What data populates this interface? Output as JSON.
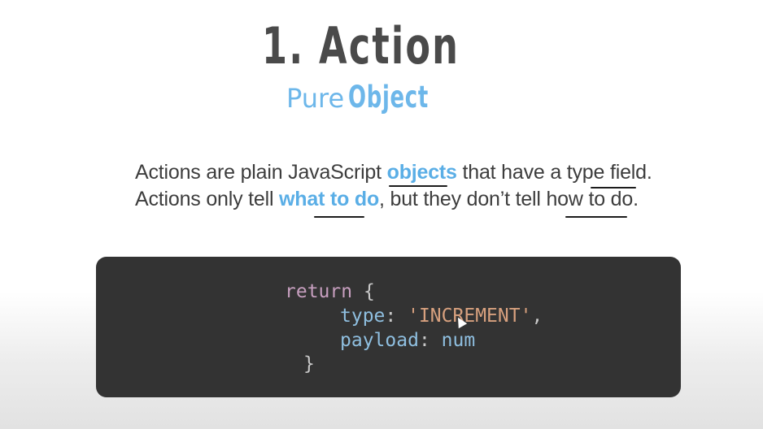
{
  "slide": {
    "title": "1. Action",
    "subtitle_plain": "Pure",
    "subtitle_bold": "Object",
    "line1": {
      "before": "Actions are plain JavaScript ",
      "highlight": "objects",
      "after": " that have a type field."
    },
    "line2": {
      "before": "Actions only tell ",
      "highlight": "what to do",
      "after": ", but they don’t tell how to do."
    }
  },
  "code": {
    "keyword": "return",
    "open_brace": "{",
    "type_key": "type",
    "colon1": ":",
    "type_value": "'INCREMENT'",
    "comma": ",",
    "payload_key": "payload",
    "colon2": ":",
    "payload_value": "num",
    "close_brace": "}"
  },
  "colors": {
    "accent": "#6db7ea",
    "code_background": "#333333"
  }
}
